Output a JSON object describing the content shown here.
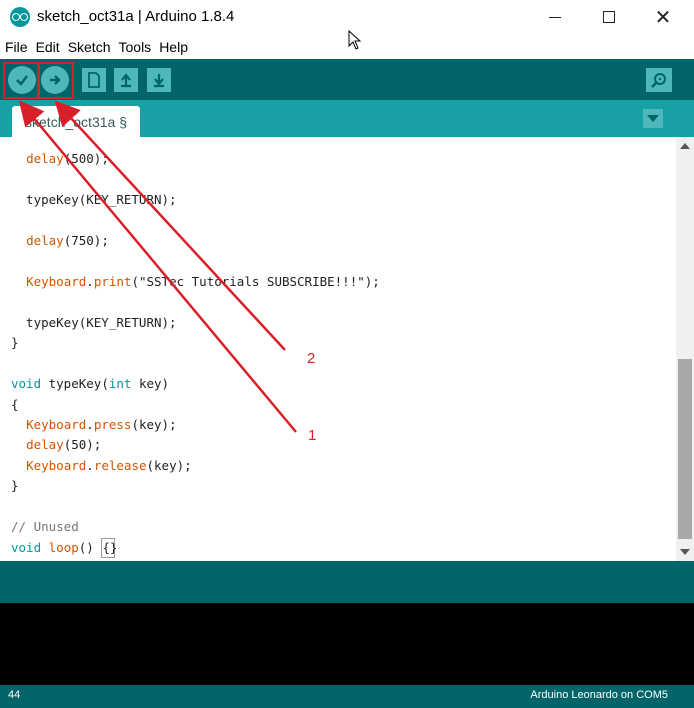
{
  "window": {
    "title": "sketch_oct31a | Arduino 1.8.4",
    "logo_icon": "arduino-logo-icon",
    "controls": [
      "minimize",
      "maximize",
      "close"
    ]
  },
  "menu": [
    "File",
    "Edit",
    "Sketch",
    "Tools",
    "Help"
  ],
  "toolbar": {
    "buttons": [
      {
        "name": "verify",
        "icon": "check-icon"
      },
      {
        "name": "upload",
        "icon": "arrow-right-icon"
      },
      {
        "name": "new",
        "icon": "new-file-icon"
      },
      {
        "name": "open",
        "icon": "arrow-up-icon"
      },
      {
        "name": "save",
        "icon": "arrow-down-icon"
      }
    ],
    "serial_monitor_icon": "magnifier-icon",
    "highlight_color": "#d9202a"
  },
  "tabs": [
    {
      "label": "sketch_oct31a §"
    }
  ],
  "code": {
    "lines": [
      "  delay(500);",
      "",
      "  typeKey(KEY_RETURN);",
      "",
      "  delay(750);",
      "",
      "  Keyboard.print(\"SSTec Tutorials SUBSCRIBE!!!\");",
      "",
      "  typeKey(KEY_RETURN);",
      "}",
      "",
      "void typeKey(int key)",
      "{",
      "  Keyboard.press(key);",
      "  delay(50);",
      "  Keyboard.release(key);",
      "}",
      "",
      "// Unused",
      "void loop() {}"
    ]
  },
  "annotations": [
    {
      "label": "1"
    },
    {
      "label": "2"
    }
  ],
  "status": {
    "line_number": "44",
    "board": "Arduino Leonardo on COM5"
  },
  "colors": {
    "toolbar_bg": "#006468",
    "tab_bar_bg": "#17a1a5",
    "button_bg": "#4db7bb",
    "keyword": "#d35400",
    "type": "#00979c",
    "console_bg": "#000000"
  }
}
